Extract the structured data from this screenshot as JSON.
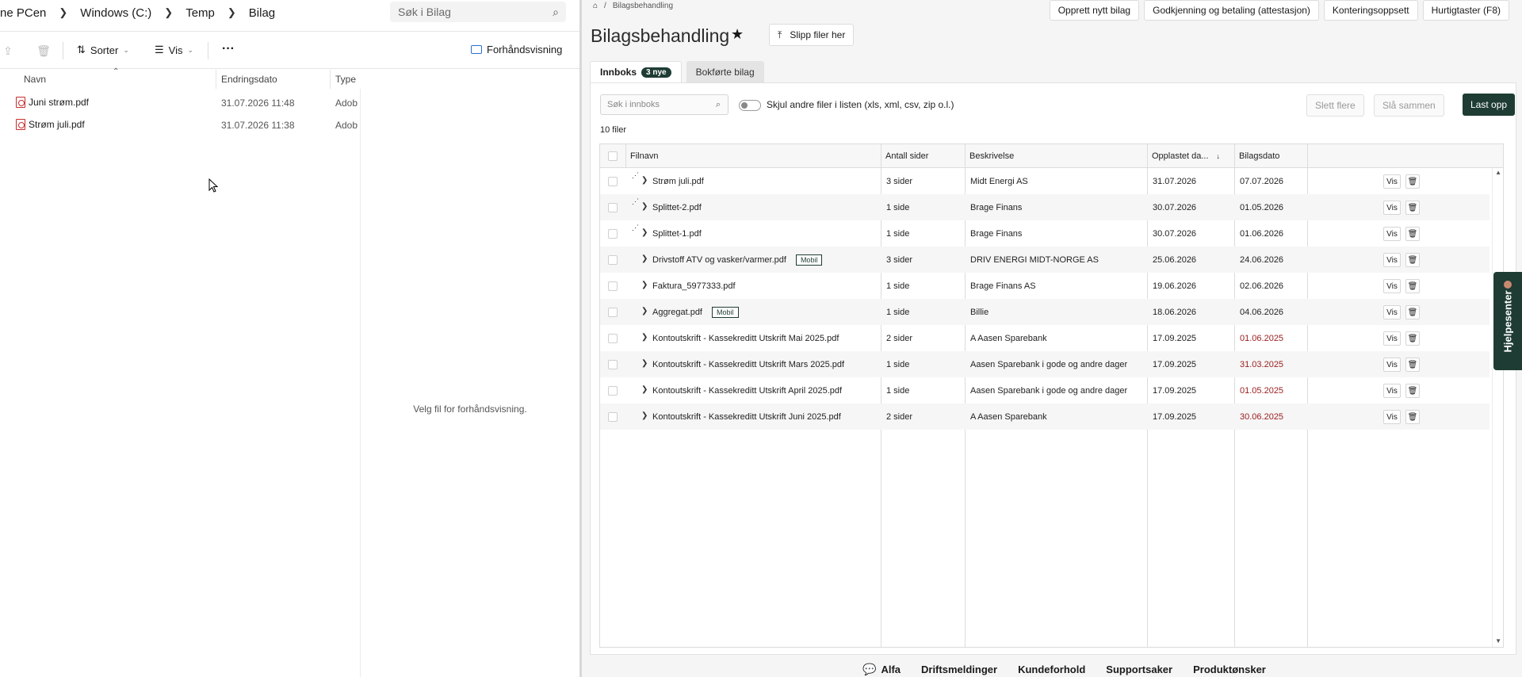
{
  "explorer": {
    "breadcrumb": [
      "ne PCen",
      "Windows (C:)",
      "Temp",
      "Bilag"
    ],
    "search_placeholder": "Søk i Bilag",
    "toolbar": {
      "sort_label": "Sorter",
      "view_label": "Vis",
      "more_label": "···",
      "preview_label": "Forhåndsvisning"
    },
    "columns": {
      "name": "Navn",
      "date": "Endringsdato",
      "type": "Type"
    },
    "files": [
      {
        "name": "Juni strøm.pdf",
        "date": "31.07.2026 11:48",
        "type": "Adob"
      },
      {
        "name": "Strøm juli.pdf",
        "date": "31.07.2026 11:38",
        "type": "Adob"
      }
    ],
    "preview_message": "Velg fil for forhåndsvisning."
  },
  "app": {
    "breadcrumb": {
      "separator": "/",
      "current": "Bilagsbehandling"
    },
    "quick_buttons": [
      "Opprett nytt bilag",
      "Godkjenning og betaling (attestasjon)",
      "Konteringsoppsett",
      "Hurtigtaster (F8)"
    ],
    "title": "Bilagsbehandling",
    "upload_label": "Slipp filer her",
    "tabs": [
      {
        "label": "Innboks",
        "badge": "3 nye"
      },
      {
        "label": "Bokførte bilag"
      }
    ],
    "search_placeholder": "Søk i innboks",
    "toggle_label": "Skjul andre filer i listen (xls, xml, csv, zip o.l.)",
    "actions": {
      "delete_many": "Slett flere",
      "merge": "Slå sammen",
      "upload": "Last opp"
    },
    "count_label": "10 filer",
    "columns": {
      "filename": "Filnavn",
      "pages": "Antall sider",
      "description": "Beskrivelse",
      "uploaded": "Opplastet da...",
      "sort_arrow": "↓",
      "voucher_date": "Bilagsdato"
    },
    "rows": [
      {
        "split": true,
        "filename": "Strøm juli.pdf",
        "tag": "",
        "pages": "3 sider",
        "description": "Midt Energi AS",
        "uploaded": "31.07.2026",
        "voucher_date": "07.07.2026",
        "date_red": false
      },
      {
        "split": true,
        "filename": "Splittet-2.pdf",
        "tag": "",
        "pages": "1 side",
        "description": "Brage Finans",
        "uploaded": "30.07.2026",
        "voucher_date": "01.05.2026",
        "date_red": false
      },
      {
        "split": true,
        "filename": "Splittet-1.pdf",
        "tag": "",
        "pages": "1 side",
        "description": "Brage Finans",
        "uploaded": "30.07.2026",
        "voucher_date": "01.06.2026",
        "date_red": false
      },
      {
        "split": false,
        "filename": "Drivstoff ATV og vasker/varmer.pdf",
        "tag": "Mobil",
        "pages": "3 sider",
        "description": "DRIV ENERGI MIDT-NORGE AS",
        "uploaded": "25.06.2026",
        "voucher_date": "24.06.2026",
        "date_red": false
      },
      {
        "split": false,
        "filename": "Faktura_5977333.pdf",
        "tag": "",
        "pages": "1 side",
        "description": "Brage Finans AS",
        "uploaded": "19.06.2026",
        "voucher_date": "02.06.2026",
        "date_red": false
      },
      {
        "split": false,
        "filename": "Aggregat.pdf",
        "tag": "Mobil",
        "pages": "1 side",
        "description": "Billie",
        "uploaded": "18.06.2026",
        "voucher_date": "04.06.2026",
        "date_red": false
      },
      {
        "split": false,
        "filename": "Kontoutskrift - Kassekreditt Utskrift Mai 2025.pdf",
        "tag": "",
        "pages": "2 sider",
        "description": "A Aasen Sparebank",
        "uploaded": "17.09.2025",
        "voucher_date": "01.06.2025",
        "date_red": true
      },
      {
        "split": false,
        "filename": "Kontoutskrift - Kassekreditt Utskrift Mars 2025.pdf",
        "tag": "",
        "pages": "1 side",
        "description": "Aasen Sparebank i gode og andre dager",
        "uploaded": "17.09.2025",
        "voucher_date": "31.03.2025",
        "date_red": true
      },
      {
        "split": false,
        "filename": "Kontoutskrift - Kassekreditt Utskrift April 2025.pdf",
        "tag": "",
        "pages": "1 side",
        "description": "Aasen Sparebank i gode og andre dager",
        "uploaded": "17.09.2025",
        "voucher_date": "01.05.2025",
        "date_red": true
      },
      {
        "split": false,
        "filename": "Kontoutskrift - Kassekreditt Utskrift Juni 2025.pdf",
        "tag": "",
        "pages": "2 sider",
        "description": "A Aasen Sparebank",
        "uploaded": "17.09.2025",
        "voucher_date": "30.06.2025",
        "date_red": true
      }
    ],
    "row_view_label": "Vis",
    "help_label": "Hjelpesenter",
    "footer": [
      "Alfa",
      "Driftsmeldinger",
      "Kundeforhold",
      "Supportsaker",
      "Produktønsker"
    ],
    "colors": {
      "brand": "#1e3c33",
      "overdue": "#9b1c1c"
    }
  }
}
